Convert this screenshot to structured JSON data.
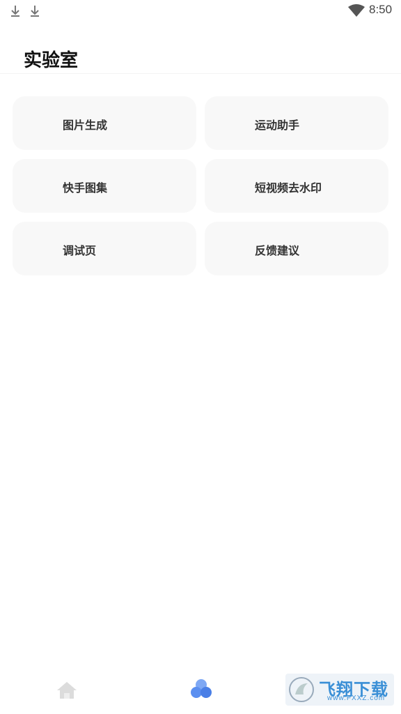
{
  "status_bar": {
    "time": "8:50",
    "icons": [
      "download-icon",
      "download-icon",
      "wifi-icon"
    ]
  },
  "header": {
    "title": "实验室"
  },
  "cards": [
    {
      "label": "图片生成"
    },
    {
      "label": "运动助手"
    },
    {
      "label": "快手图集"
    },
    {
      "label": "短视频去水印"
    },
    {
      "label": "调试页"
    },
    {
      "label": "反馈建议"
    }
  ],
  "tab_bar": {
    "tabs": [
      {
        "icon": "home-icon",
        "active": false
      },
      {
        "icon": "lab-circles-icon",
        "active": true
      }
    ],
    "active_color": "#5b8ff0",
    "inactive_color": "#d8d8d8"
  },
  "watermark": {
    "text": "飞翔下载",
    "sub": "www.FXXZ.com"
  }
}
